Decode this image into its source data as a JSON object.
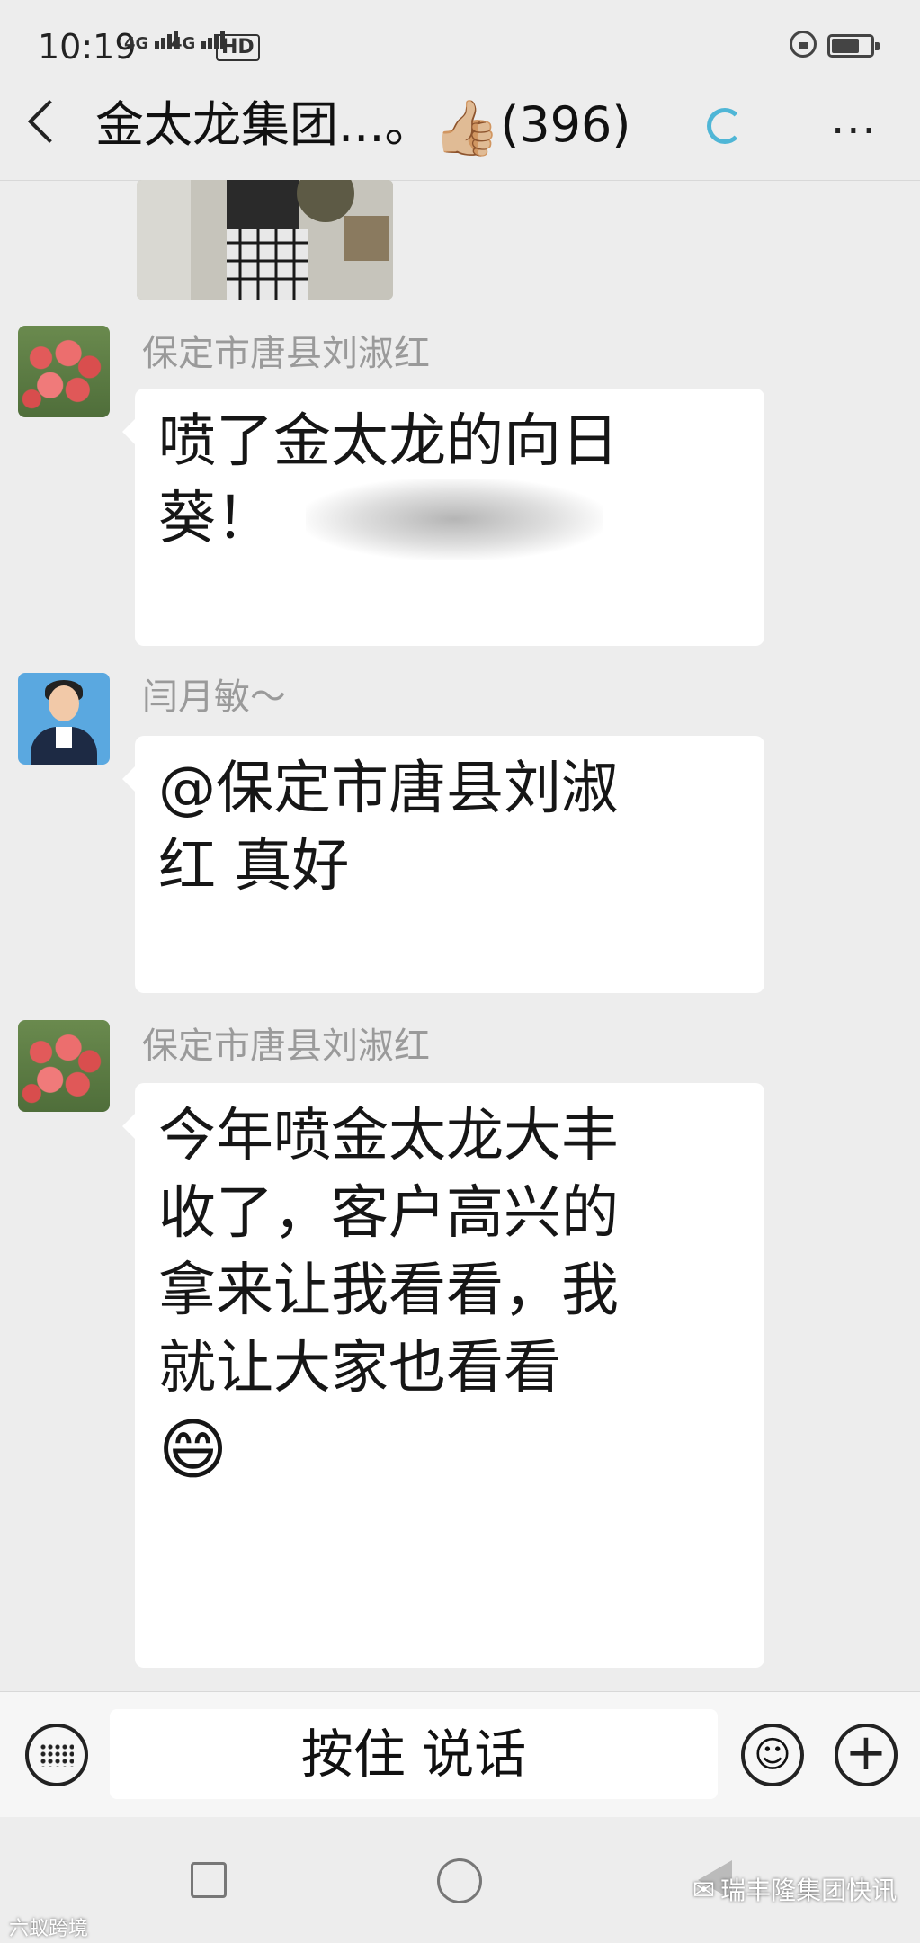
{
  "status": {
    "time": "10:19",
    "net1": "4G",
    "net2": "4G",
    "hd": "HD"
  },
  "header": {
    "title": "金太龙集团...。",
    "title_emoji": "👍🏼",
    "member_count": "(396)"
  },
  "messages": [
    {
      "sender": "保定市唐县刘淑红",
      "lines": [
        "喷了金太龙的向日",
        "葵！"
      ]
    },
    {
      "sender": "闫月敏～",
      "lines": [
        "@保定市唐县刘淑",
        "红  真好"
      ]
    },
    {
      "sender": "保定市唐县刘淑红",
      "lines": [
        "今年喷金太龙大丰",
        "收了，客户高兴的",
        "拿来让我看看，我",
        "就让大家也看看"
      ],
      "emoji": "😄"
    }
  ],
  "input_bar": {
    "hold_to_talk": "按住 说话"
  },
  "watermarks": {
    "left": "六蚁跨境",
    "right": "瑞丰隆集团快讯"
  }
}
